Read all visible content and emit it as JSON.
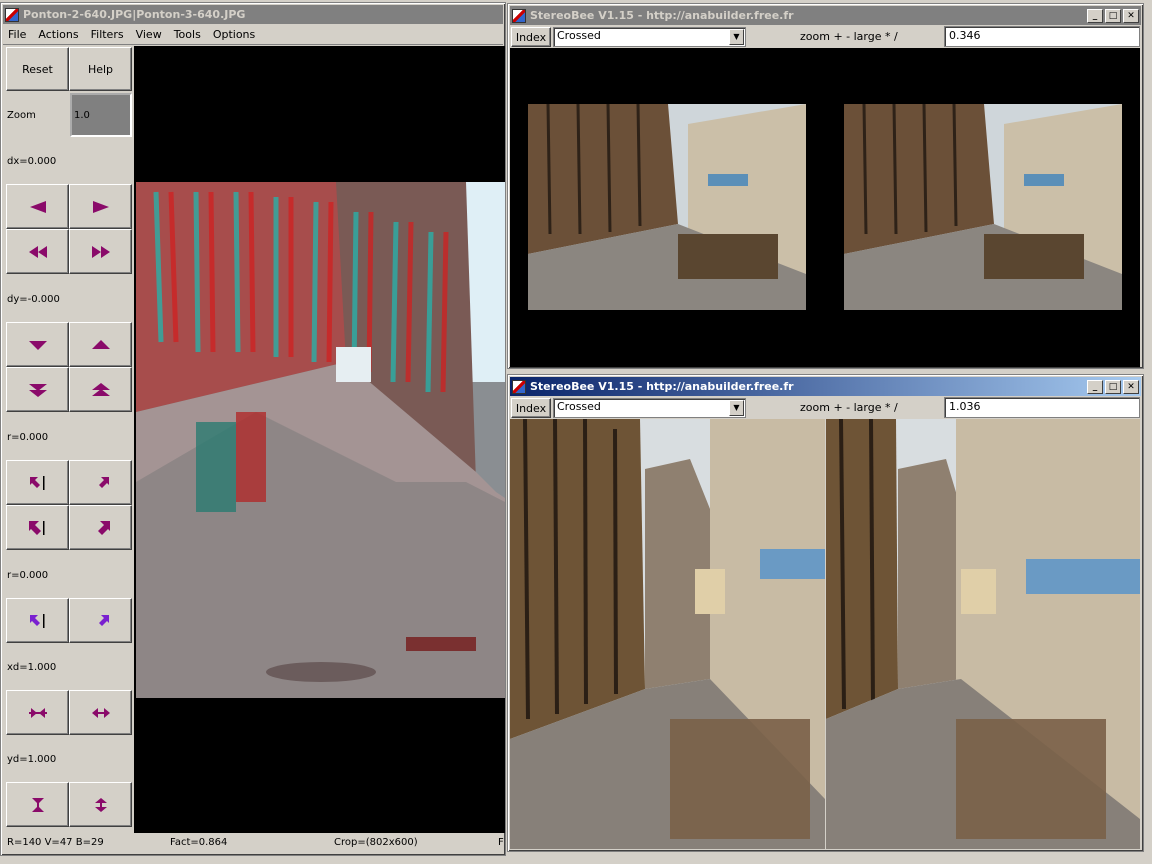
{
  "left_window": {
    "title": "Ponton-2-640.JPG|Ponton-3-640.JPG",
    "menu": [
      "File",
      "Actions",
      "Filters",
      "View",
      "Tools",
      "Options"
    ],
    "reset_label": "Reset",
    "help_label": "Help",
    "zoom_label": "Zoom",
    "zoom_value": "1.0",
    "dx_label": "dx=0.000",
    "dy_label": "dy=-0.000",
    "r1_label": "r=0.000",
    "r2_label": "r=0.000",
    "xd_label": "xd=1.000",
    "yd_label": "yd=1.000",
    "status_rgb": "R=140 V=47 B=29",
    "status_fact": "Fact=0.864",
    "status_crop": "Crop=(802x600)",
    "status_f": "F"
  },
  "top_right_window": {
    "title": "StereoBee V1.15 - http://anabuilder.free.fr",
    "index_label": "Index",
    "mode_value": "Crossed",
    "zoom_caption": "zoom + - large * /",
    "zoom_value": "0.346"
  },
  "bottom_right_window": {
    "title": "StereoBee V1.15 - http://anabuilder.free.fr",
    "index_label": "Index",
    "mode_value": "Crossed",
    "zoom_caption": "zoom + - large * /",
    "zoom_value": "1.036"
  },
  "title_buttons": {
    "min": "_",
    "max": "□",
    "close": "✕"
  },
  "colors": {
    "active_title": "#0a246a",
    "inactive_title": "#808080",
    "icon_purple": "#8a0a6a"
  }
}
